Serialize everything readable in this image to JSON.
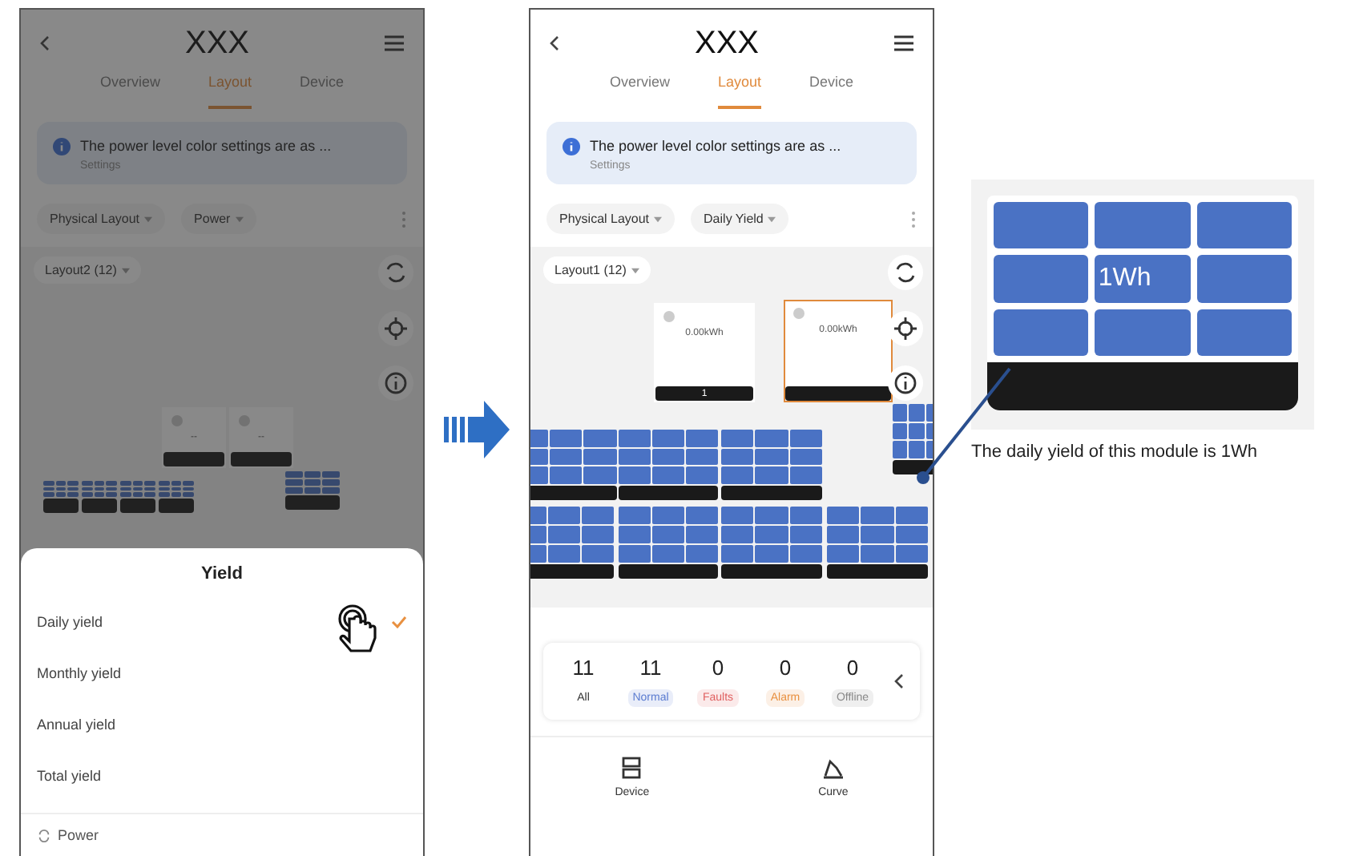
{
  "screens": [
    {
      "title": "XXX",
      "tabs": [
        {
          "label": "Overview",
          "selected": false
        },
        {
          "label": "Layout",
          "selected": true
        },
        {
          "label": "Device",
          "selected": false
        }
      ],
      "banner": {
        "text": "The power level color settings are as ...",
        "link": "Settings"
      },
      "filters": [
        "Physical Layout",
        "Power"
      ],
      "layout_selector": "Layout2 (12)",
      "dimmed": true,
      "modules": [
        {
          "kind": "card",
          "value": "--",
          "selected": false
        },
        {
          "kind": "card",
          "value": "--",
          "selected": false
        },
        {
          "kind": "panel"
        },
        {
          "kind": "panel"
        },
        {
          "kind": "panel"
        },
        {
          "kind": "panel"
        },
        {
          "kind": "panel"
        }
      ],
      "sheet": {
        "title": "Yield",
        "options": [
          {
            "label": "Daily yield",
            "selected": true
          },
          {
            "label": "Monthly yield",
            "selected": false
          },
          {
            "label": "Annual yield",
            "selected": false
          },
          {
            "label": "Total yield",
            "selected": false
          }
        ],
        "footer": "Power"
      }
    },
    {
      "title": "XXX",
      "tabs": [
        {
          "label": "Overview",
          "selected": false
        },
        {
          "label": "Layout",
          "selected": true
        },
        {
          "label": "Device",
          "selected": false
        }
      ],
      "banner": {
        "text": "The power level color settings are as ...",
        "link": "Settings"
      },
      "filters": [
        "Physical Layout",
        "Daily Yield"
      ],
      "layout_selector": "Layout1 (12)",
      "dimmed": false,
      "modules": [
        {
          "kind": "card",
          "value": "0.00kWh",
          "number": "1",
          "selected": false
        },
        {
          "kind": "card",
          "value": "0.00kWh",
          "selected": true
        },
        {
          "kind": "panel"
        },
        {
          "kind": "panel"
        },
        {
          "kind": "panel"
        },
        {
          "kind": "panel"
        },
        {
          "kind": "panel"
        },
        {
          "kind": "panel"
        },
        {
          "kind": "panel"
        },
        {
          "kind": "panel"
        }
      ],
      "stats": [
        {
          "count": "11",
          "label": "All"
        },
        {
          "count": "11",
          "label": "Normal",
          "color": "#5a7bd0"
        },
        {
          "count": "0",
          "label": "Faults",
          "color": "#e06060"
        },
        {
          "count": "0",
          "label": "Alarm",
          "color": "#e89040"
        },
        {
          "count": "0",
          "label": "Offline",
          "color": "#888888"
        }
      ],
      "nav": [
        {
          "label": "Device",
          "kind": "device"
        },
        {
          "label": "Curve",
          "kind": "curve"
        }
      ]
    }
  ],
  "callout": {
    "value": "1Wh",
    "caption": "The daily yield of this module is 1Wh"
  }
}
